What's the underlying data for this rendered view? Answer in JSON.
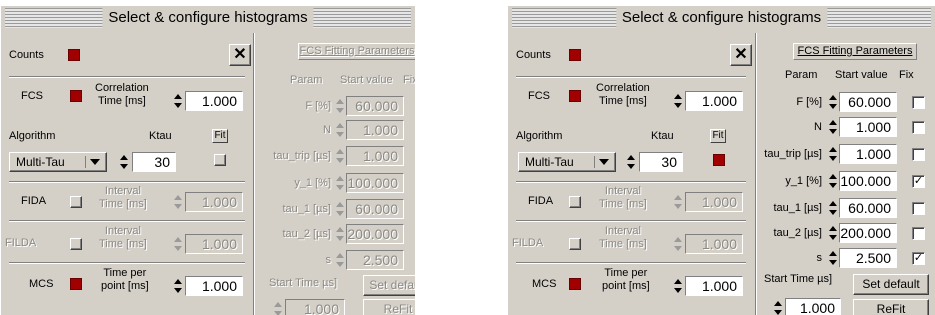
{
  "title": "Select & configure histograms",
  "left": {
    "counts_label": "Counts",
    "close_symbol": "✕",
    "fcs_label": "FCS",
    "correlation_time_label": "Correlation\nTime [ms]",
    "correlation_time_value": "1.000",
    "algorithm_label": "Algorithm",
    "ktau_label": "Ktau",
    "fit_label": "Fit",
    "algorithm_value": "Multi-Tau",
    "ktau_value": "30",
    "fida_label": "FIDA",
    "fida_interval_label": "Interval\nTime [ms]",
    "fida_interval_value": "1.000",
    "filda_label": "FILDA",
    "filda_interval_label": "Interval\nTime [ms]",
    "filda_interval_value": "1.000",
    "mcs_label": "MCS",
    "mcs_time_label": "Time per\npoint [ms]",
    "mcs_time_value": "1.000",
    "fcs_fitting_button": "FCS Fitting Parameters",
    "param_header": "Param",
    "start_value_header": "Start value",
    "fix_header": "Fix",
    "params": [
      {
        "name": "F [%]",
        "value": "60.000",
        "fix": false
      },
      {
        "name": "N",
        "value": "1.000",
        "fix": false
      },
      {
        "name": "tau_trip [µs]",
        "value": "1.000",
        "fix": false
      },
      {
        "name": "y_1 [%]",
        "value": "100.000",
        "fix": true
      },
      {
        "name": "tau_1 [µs]",
        "value": "60.000",
        "fix": false
      },
      {
        "name": "tau_2 [µs]",
        "value": "200.000",
        "fix": false
      },
      {
        "name": "s",
        "value": "2.500",
        "fix": true
      }
    ],
    "start_time_label": "Start Time µs]",
    "start_time_value": "1.000",
    "set_default_button": "Set default",
    "refit_button": "ReFit",
    "check_mark": "✓"
  },
  "right": {
    "counts_label": "Counts",
    "close_symbol": "✕",
    "fcs_label": "FCS",
    "correlation_time_label": "Correlation\nTime [ms]",
    "correlation_time_value": "1.000",
    "algorithm_label": "Algorithm",
    "ktau_label": "Ktau",
    "fit_label": "Fit",
    "algorithm_value": "Multi-Tau",
    "ktau_value": "30",
    "fida_label": "FIDA",
    "fida_interval_label": "Interval\nTime [ms]",
    "fida_interval_value": "1.000",
    "filda_label": "FILDA",
    "filda_interval_label": "Interval\nTime [ms]",
    "filda_interval_value": "1.000",
    "mcs_label": "MCS",
    "mcs_time_label": "Time per\npoint [ms]",
    "mcs_time_value": "1.000",
    "fcs_fitting_button": "FCS Fitting Parameters",
    "param_header": "Param",
    "start_value_header": "Start value",
    "fix_header": "Fix",
    "params": [
      {
        "name": "F [%]",
        "value": "60.000",
        "fix": false
      },
      {
        "name": "N",
        "value": "1.000",
        "fix": false
      },
      {
        "name": "tau_trip [µs]",
        "value": "1.000",
        "fix": false
      },
      {
        "name": "y_1 [%]",
        "value": "100.000",
        "fix": true
      },
      {
        "name": "tau_1 [µs]",
        "value": "60.000",
        "fix": false
      },
      {
        "name": "tau_2 [µs]",
        "value": "200.000",
        "fix": false
      },
      {
        "name": "s",
        "value": "2.500",
        "fix": true
      }
    ],
    "start_time_label": "Start Time µs]",
    "start_time_value": "1.000",
    "set_default_button": "Set default",
    "refit_button": "ReFit",
    "check_mark": "✓"
  },
  "colors": {
    "indicator_red": "#a00000",
    "panel_face": "#d4d0c8",
    "disabled_text": "#8c8a84"
  }
}
